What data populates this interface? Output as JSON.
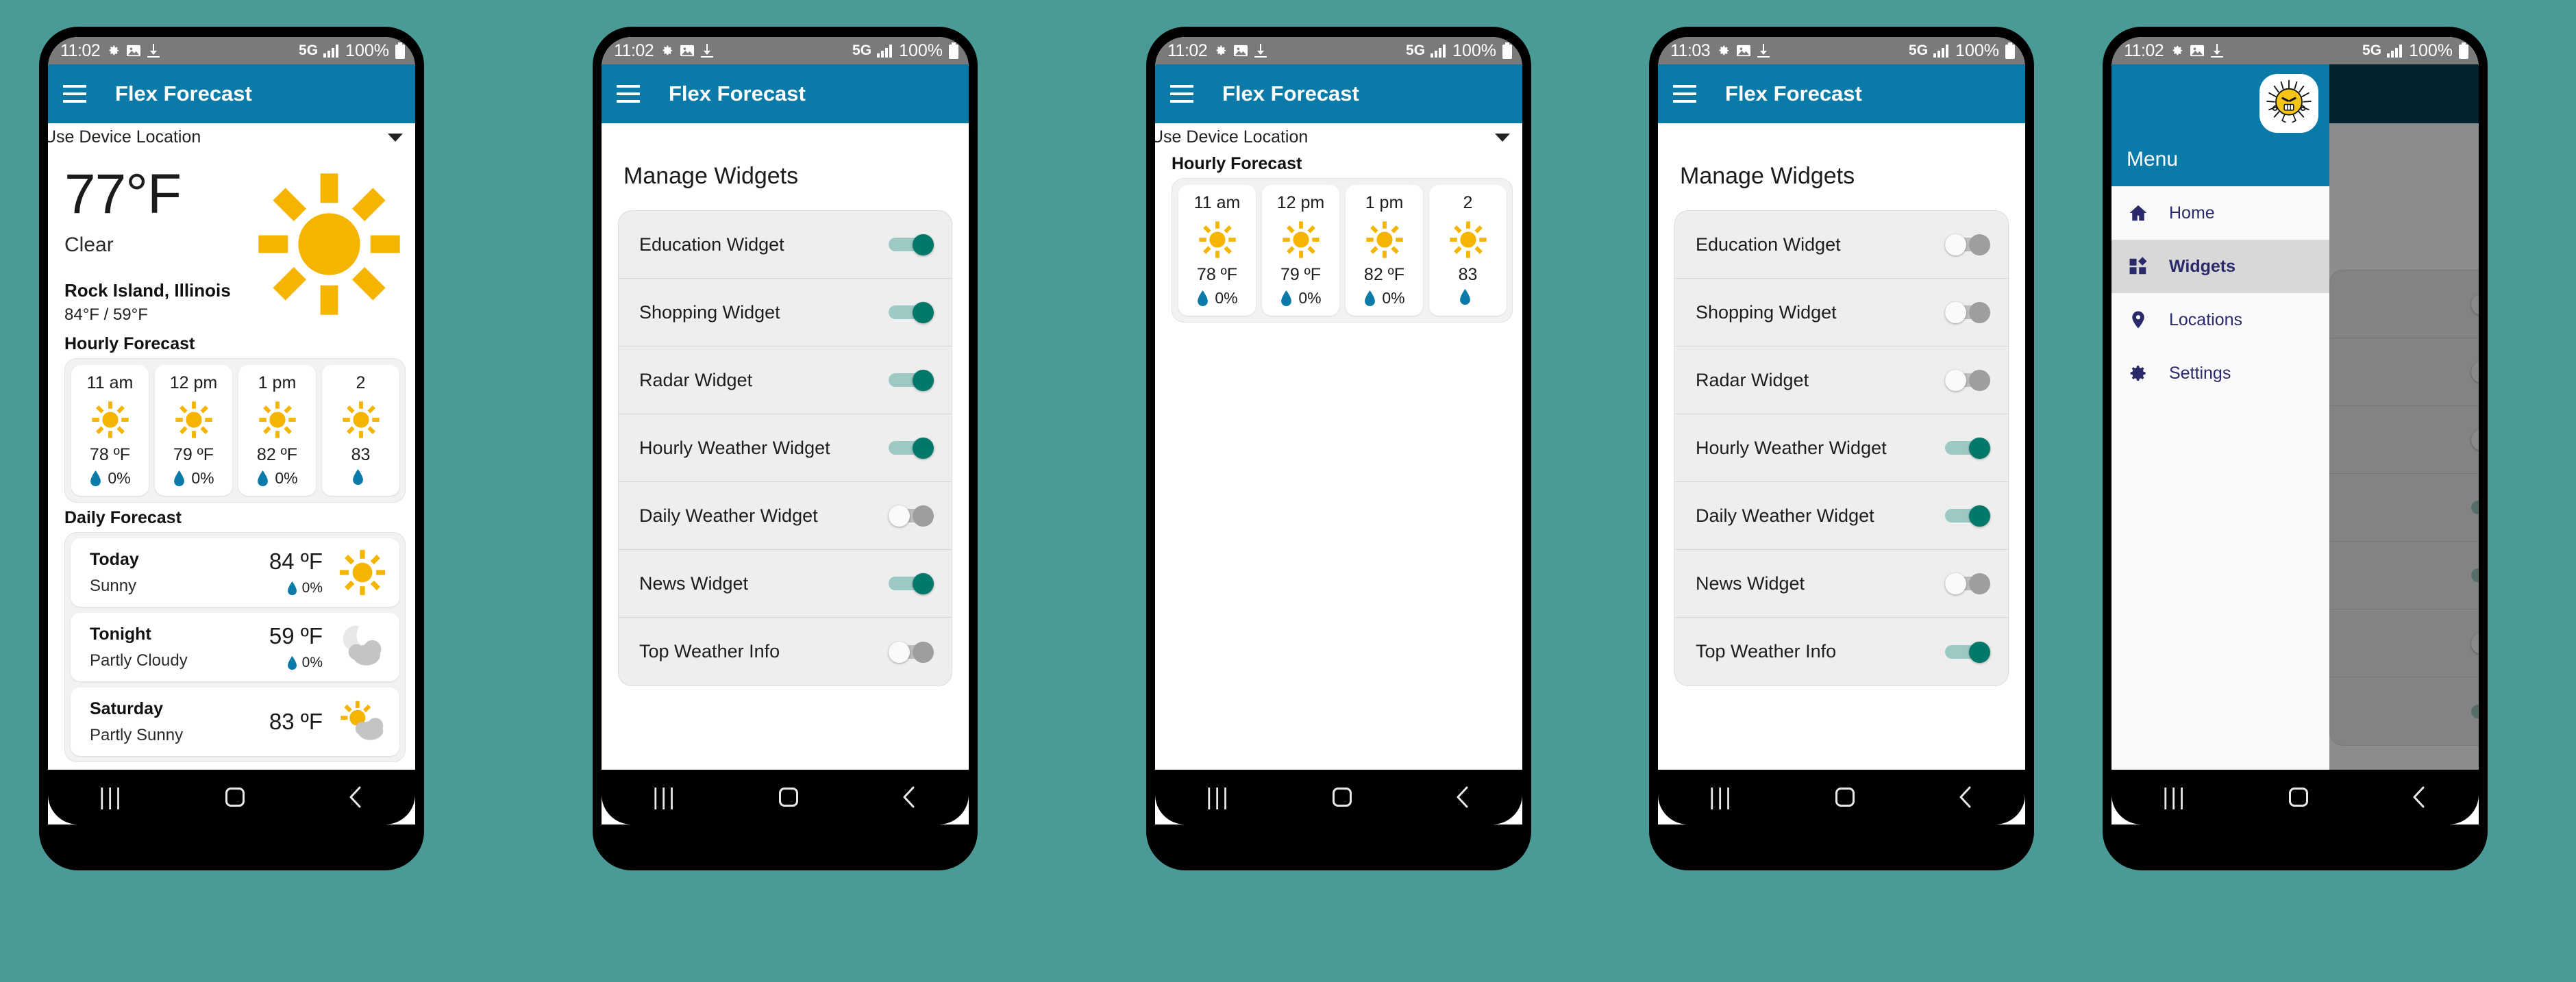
{
  "canvas": {
    "background_color": "#4a9b96"
  },
  "theme": {
    "appbar_color": "#0a7ba8",
    "statusbar_color": "#7a7a7a",
    "toggle_on_color": "#00796b",
    "toggle_off_color": "#9e9e9e",
    "sun_color": "#f5b400",
    "rain_drop_color": "#0a7ba8",
    "drawer_text_color": "#2a2a6a"
  },
  "status_bar": {
    "time_1102": "11:02",
    "time_1103": "11:03",
    "network": "5G",
    "battery": "100%",
    "icons": [
      "gear-icon",
      "image-icon",
      "download-icon",
      "signal-bars-icon",
      "battery-icon"
    ]
  },
  "app": {
    "title": "Flex Forecast",
    "menu_icon": "hamburger-icon"
  },
  "nav_bar": {
    "recents_label": "|||",
    "home_label": "home-icon",
    "back_label": "back-icon"
  },
  "location_spinner": {
    "value": "Use Device Location",
    "caret": "chevron-down-icon"
  },
  "phone1": {
    "current": {
      "temperature": "77°F",
      "condition": "Clear",
      "location": "Rock Island, Illinois",
      "high_low": "84°F / 59°F",
      "icon": "sun-icon"
    },
    "hourly_title": "Hourly Forecast",
    "daily_title": "Daily Forecast",
    "hourly": [
      {
        "hour": "11 am",
        "temp": "78 ºF",
        "precip": "0%",
        "icon": "sun-icon"
      },
      {
        "hour": "12 pm",
        "temp": "79 ºF",
        "precip": "0%",
        "icon": "sun-icon"
      },
      {
        "hour": "1 pm",
        "temp": "82 ºF",
        "precip": "0%",
        "icon": "sun-icon"
      },
      {
        "hour": "2",
        "temp": "83",
        "precip": "",
        "icon": "sun-icon"
      }
    ],
    "daily": [
      {
        "day": "Today",
        "desc": "Sunny",
        "temp": "84 ºF",
        "precip": "0%",
        "icon": "sun-icon"
      },
      {
        "day": "Tonight",
        "desc": "Partly Cloudy",
        "temp": "59 ºF",
        "precip": "0%",
        "icon": "moon-cloud-icon"
      },
      {
        "day": "Saturday",
        "desc": "Partly Sunny",
        "temp": "83 ºF",
        "precip": "",
        "icon": "sun-cloud-icon"
      }
    ]
  },
  "phone3": {
    "hourly_title": "Hourly Forecast",
    "hourly": [
      {
        "hour": "11 am",
        "temp": "78 ºF",
        "precip": "0%",
        "icon": "sun-icon"
      },
      {
        "hour": "12 pm",
        "temp": "79 ºF",
        "precip": "0%",
        "icon": "sun-icon"
      },
      {
        "hour": "1 pm",
        "temp": "82 ºF",
        "precip": "0%",
        "icon": "sun-icon"
      },
      {
        "hour": "2",
        "temp": "83",
        "precip": "",
        "icon": "sun-icon"
      }
    ]
  },
  "manage_widgets": {
    "title": "Manage Widgets",
    "labels": [
      "Education Widget",
      "Shopping Widget",
      "Radar Widget",
      "Hourly Weather Widget",
      "Daily Weather Widget",
      "News Widget",
      "Top Weather Info"
    ],
    "phone2_states": [
      true,
      true,
      true,
      true,
      false,
      true,
      false
    ],
    "phone4_states": [
      false,
      false,
      false,
      true,
      true,
      false,
      true
    ]
  },
  "drawer": {
    "menu_label": "Menu",
    "logo": "angry-sun-logo-icon",
    "items": [
      {
        "label": "Home",
        "icon": "home-icon",
        "active": false
      },
      {
        "label": "Widgets",
        "icon": "widgets-icon",
        "active": true
      },
      {
        "label": "Locations",
        "icon": "location-pin-icon",
        "active": false
      },
      {
        "label": "Settings",
        "icon": "gear-icon",
        "active": false
      }
    ]
  }
}
